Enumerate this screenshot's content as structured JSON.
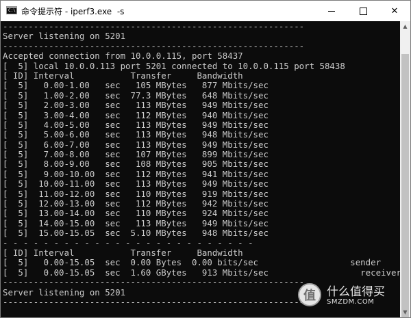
{
  "window": {
    "title": "命令提示符 - iperf3.exe  -s",
    "controls": {
      "minimize": "—",
      "maximize": "☐",
      "close": "✕"
    },
    "icon_label": "C:\\"
  },
  "console": {
    "lines": [
      "-----------------------------------------------------------",
      "Server listening on 5201",
      "-----------------------------------------------------------",
      "Accepted connection from 10.0.0.115, port 58437",
      "[  5] local 10.0.0.113 port 5201 connected to 10.0.0.115 port 58438",
      "[ ID] Interval           Transfer     Bandwidth",
      "[  5]   0.00-1.00   sec   105 MBytes   877 Mbits/sec",
      "[  5]   1.00-2.00   sec  77.3 MBytes   648 Mbits/sec",
      "[  5]   2.00-3.00   sec   113 MBytes   949 Mbits/sec",
      "[  5]   3.00-4.00   sec   112 MBytes   940 Mbits/sec",
      "[  5]   4.00-5.00   sec   113 MBytes   949 Mbits/sec",
      "[  5]   5.00-6.00   sec   113 MBytes   948 Mbits/sec",
      "[  5]   6.00-7.00   sec   113 MBytes   949 Mbits/sec",
      "[  5]   7.00-8.00   sec   107 MBytes   899 Mbits/sec",
      "[  5]   8.00-9.00   sec   108 MBytes   905 Mbits/sec",
      "[  5]   9.00-10.00  sec   112 MBytes   941 Mbits/sec",
      "[  5]  10.00-11.00  sec   113 MBytes   949 Mbits/sec",
      "[  5]  11.00-12.00  sec   110 MBytes   919 Mbits/sec",
      "[  5]  12.00-13.00  sec   112 MBytes   942 Mbits/sec",
      "[  5]  13.00-14.00  sec   110 MBytes   924 Mbits/sec",
      "[  5]  14.00-15.00  sec   113 MBytes   949 Mbits/sec",
      "[  5]  15.00-15.05  sec  5.10 MBytes   948 Mbits/sec",
      "- - - - - - - - - - - - - - - - - - - - - - - - -",
      "[ ID] Interval           Transfer     Bandwidth",
      "[  5]   0.00-15.05  sec  0.00 Bytes  0.00 bits/sec                  sender",
      "[  5]   0.00-15.05  sec  1.60 GBytes   913 Mbits/sec                  receiver",
      "-----------------------------------------------------------",
      "Server listening on 5201",
      "-----------------------------------------------------------"
    ]
  },
  "scrollbar": {
    "up": "▲",
    "down": "▼"
  },
  "watermark": {
    "badge": "值",
    "main": "什么值得买",
    "sub": "SMZDM.COM"
  },
  "colors": {
    "console_bg": "#0c0c0c",
    "console_text": "#cccccc",
    "titlebar_bg": "#ffffff"
  }
}
